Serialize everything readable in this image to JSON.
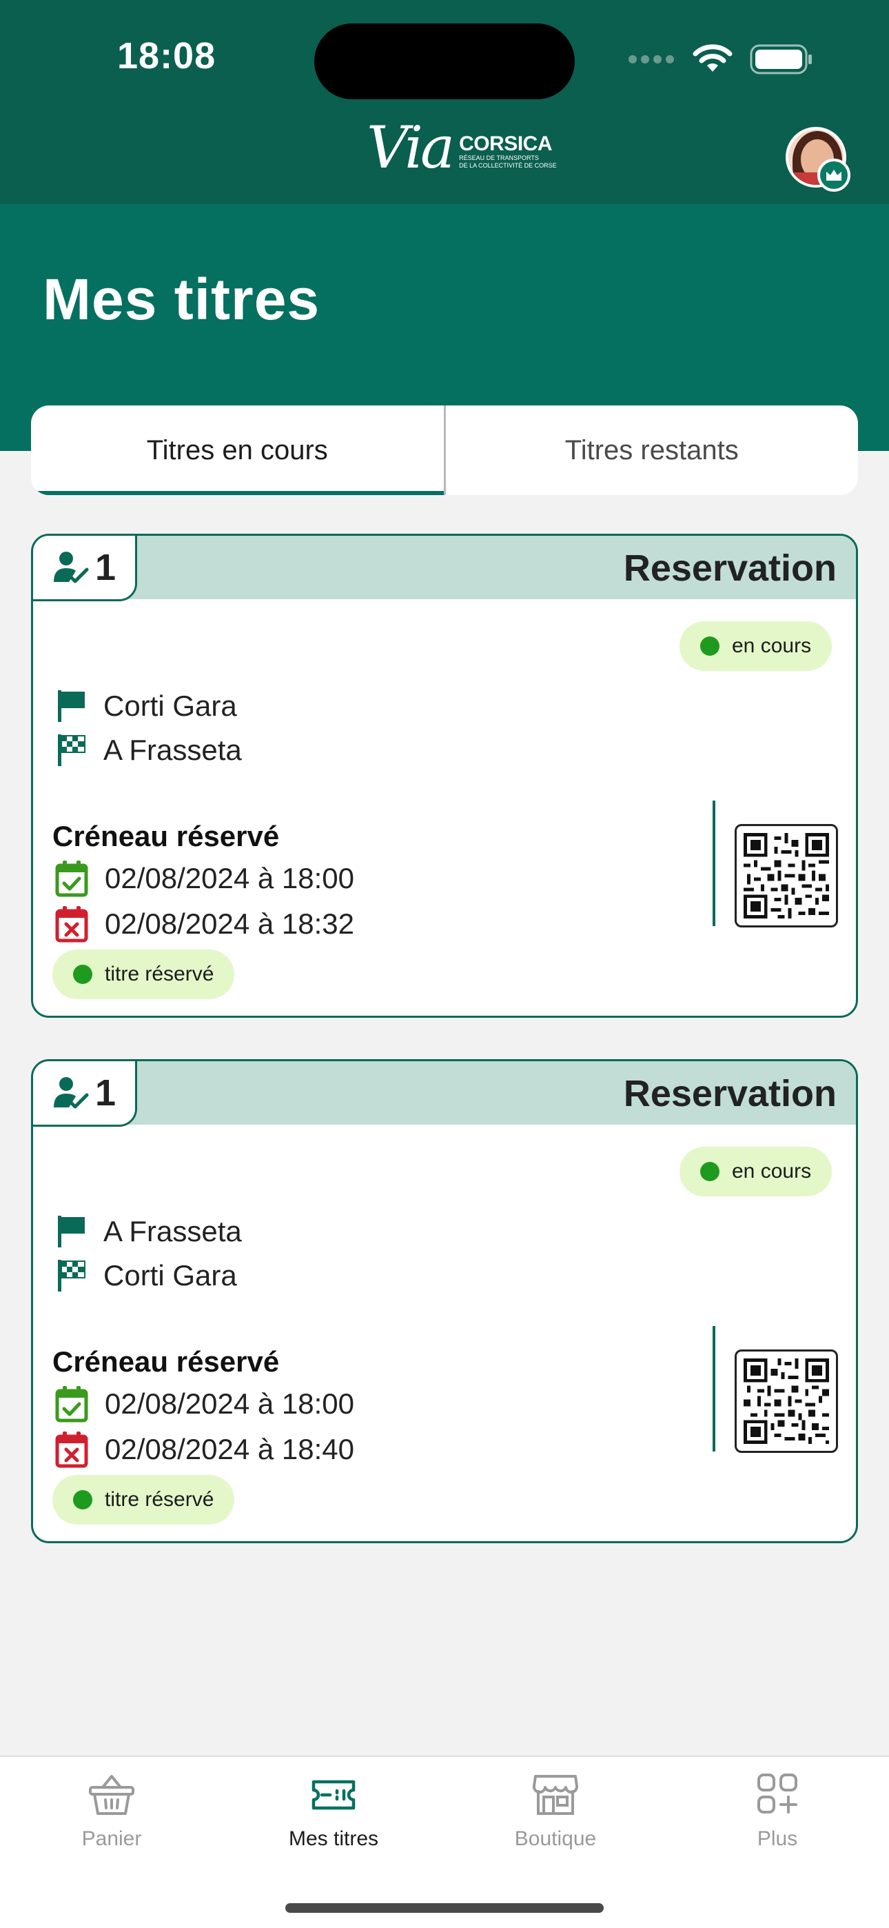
{
  "status_bar": {
    "time": "18:08"
  },
  "header": {
    "logo": {
      "via": "Via",
      "title": "CORSICA",
      "subtitle_1": "RÉSEAU DE TRANSPORTS",
      "subtitle_2": "DE LA COLLECTIVITÉ DE CORSE"
    },
    "page_title": "Mes titres"
  },
  "tabs": [
    {
      "label": "Titres en cours",
      "active": true
    },
    {
      "label": "Titres restants",
      "active": false
    }
  ],
  "tickets": [
    {
      "passengers": "1",
      "type": "Reservation",
      "status": "en cours",
      "from": "Corti Gara",
      "to": "A Frasseta",
      "slot_title": "Créneau réservé",
      "start": "02/08/2024 à 18:00",
      "end": "02/08/2024 à 18:32",
      "booking_status": "titre réservé"
    },
    {
      "passengers": "1",
      "type": "Reservation",
      "status": "en cours",
      "from": "A Frasseta",
      "to": "Corti Gara",
      "slot_title": "Créneau réservé",
      "start": "02/08/2024 à 18:00",
      "end": "02/08/2024 à 18:40",
      "booking_status": "titre réservé"
    }
  ],
  "tab_bar": [
    {
      "label": "Panier",
      "icon": "basket-icon",
      "active": false
    },
    {
      "label": "Mes titres",
      "icon": "ticket-icon",
      "active": true
    },
    {
      "label": "Boutique",
      "icon": "shop-icon",
      "active": false
    },
    {
      "label": "Plus",
      "icon": "grid-plus-icon",
      "active": false
    }
  ],
  "colors": {
    "header_dark": "#0a5f4f",
    "brand_green": "#05705f",
    "card_header": "#c1ddd6",
    "pill_bg": "#e4f7c9",
    "status_dot": "#1e9a1e",
    "calendar_ok": "#3a9a1e",
    "calendar_end": "#d0202e"
  }
}
